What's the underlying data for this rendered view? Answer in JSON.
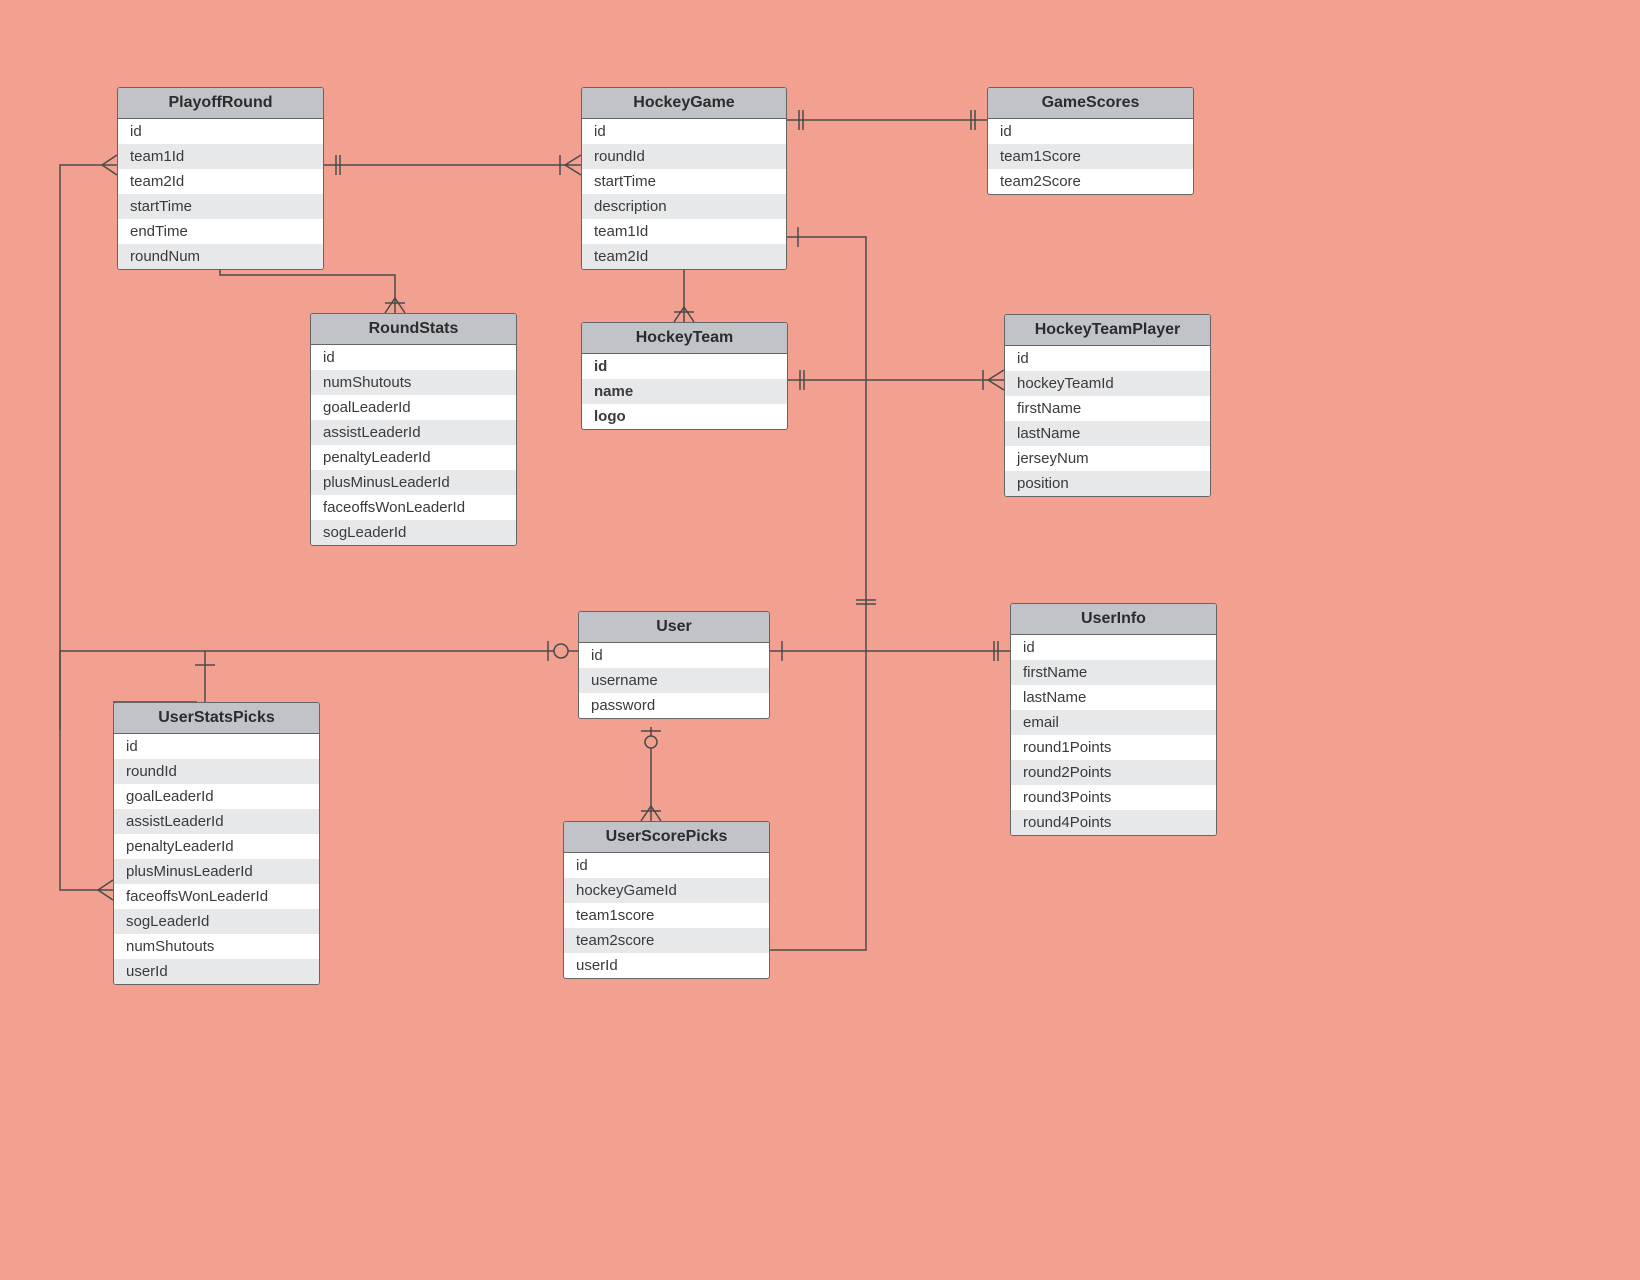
{
  "entities": {
    "playoffRound": {
      "title": "PlayoffRound",
      "attrs": [
        "id",
        "team1Id",
        "team2Id",
        "startTime",
        "endTime",
        "roundNum"
      ]
    },
    "hockeyGame": {
      "title": "HockeyGame",
      "attrs": [
        "id",
        "roundId",
        "startTime",
        "description",
        "team1Id",
        "team2Id"
      ]
    },
    "gameScores": {
      "title": "GameScores",
      "attrs": [
        "id",
        "team1Score",
        "team2Score"
      ]
    },
    "roundStats": {
      "title": "RoundStats",
      "attrs": [
        "id",
        "numShutouts",
        "goalLeaderId",
        "assistLeaderId",
        "penaltyLeaderId",
        "plusMinusLeaderId",
        "faceoffsWonLeaderId",
        "sogLeaderId"
      ]
    },
    "hockeyTeam": {
      "title": "HockeyTeam",
      "attrs": [
        "id",
        "name",
        "logo"
      ],
      "bold": true
    },
    "hockeyTeamPlayer": {
      "title": "HockeyTeamPlayer",
      "attrs": [
        "id",
        "hockeyTeamId",
        "firstName",
        "lastName",
        "jerseyNum",
        "position"
      ]
    },
    "user": {
      "title": "User",
      "attrs": [
        "id",
        "username",
        "password"
      ]
    },
    "userInfo": {
      "title": "UserInfo",
      "attrs": [
        "id",
        "firstName",
        "lastName",
        "email",
        "round1Points",
        "round2Points",
        "round3Points",
        "round4Points"
      ]
    },
    "userStatsPicks": {
      "title": "UserStatsPicks",
      "attrs": [
        "id",
        "roundId",
        "goalLeaderId",
        "assistLeaderId",
        "penaltyLeaderId",
        "plusMinusLeaderId",
        "faceoffsWonLeaderId",
        "sogLeaderId",
        "numShutouts",
        "userId"
      ]
    },
    "userScorePicks": {
      "title": "UserScorePicks",
      "attrs": [
        "id",
        "hockeyGameId",
        "team1score",
        "team2score",
        "userId"
      ]
    }
  }
}
